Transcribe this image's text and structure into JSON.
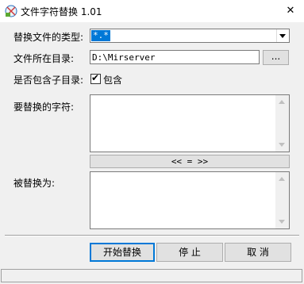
{
  "window": {
    "title": "文件字符替换 1.01"
  },
  "labels": {
    "replace_type": "替换文件的类型:",
    "directory": "文件所在目录:",
    "include_subdirs": "是否包含子目录:",
    "find_text": "要替换的字符:",
    "replace_with": "被替换为:"
  },
  "fields": {
    "file_type": "*.*",
    "directory_path": "D:\\Mirserver",
    "include_subdirs_checked": true,
    "include_subdirs_label": "包含",
    "find_value": "",
    "replace_value": ""
  },
  "buttons": {
    "browse": "...",
    "swap": "<< = >>",
    "start": "开始替换",
    "stop": "停  止",
    "cancel": "取 消",
    "close": "✕"
  },
  "icons": {
    "app": "app-icon",
    "close": "close-icon",
    "dropdown": "chevron-down-icon",
    "check": "checkmark-icon"
  },
  "colors": {
    "accent": "#0078d7",
    "background": "#f0f0f0"
  }
}
